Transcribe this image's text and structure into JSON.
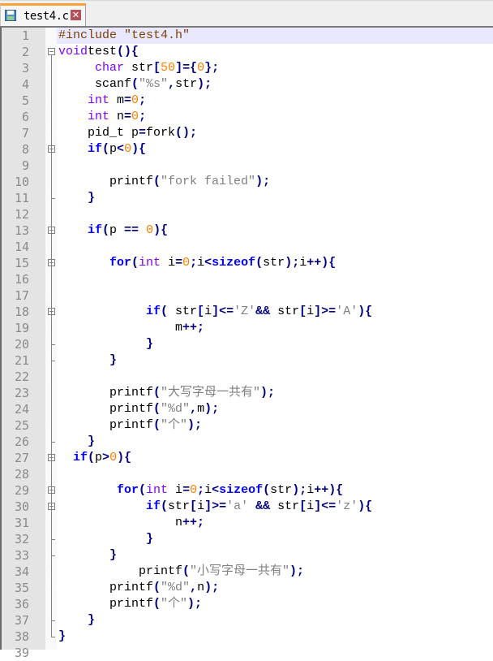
{
  "tab": {
    "filename": "test4.c",
    "save_icon": "floppy-disk-icon",
    "close_icon": "close-icon"
  },
  "editor": {
    "current_line": 1,
    "lines": [
      {
        "n": "1",
        "indent": 0,
        "tokens": [
          [
            "pp",
            "#include \"test4.h\""
          ]
        ],
        "fold": ""
      },
      {
        "n": "2",
        "indent": -1,
        "tokens": [
          [
            "ty",
            "void"
          ],
          [
            "",
            "test"
          ],
          [
            "op",
            "(){"
          ]
        ],
        "fold": "open"
      },
      {
        "n": "3",
        "indent": 5,
        "tokens": [
          [
            "ty",
            "char"
          ],
          [
            "",
            " str"
          ],
          [
            "op",
            "["
          ],
          [
            "num",
            "50"
          ],
          [
            "op",
            "]={"
          ],
          [
            "num",
            "0"
          ],
          [
            "op",
            "};"
          ]
        ],
        "fold": ""
      },
      {
        "n": "4",
        "indent": 5,
        "tokens": [
          [
            "",
            "scanf"
          ],
          [
            "op",
            "("
          ],
          [
            "str",
            "\"%s\""
          ],
          [
            "op",
            ","
          ],
          [
            "",
            "str"
          ],
          [
            "op",
            ");"
          ]
        ],
        "fold": ""
      },
      {
        "n": "5",
        "indent": 4,
        "tokens": [
          [
            "ty",
            "int"
          ],
          [
            "",
            " m"
          ],
          [
            "op",
            "="
          ],
          [
            "num",
            "0"
          ],
          [
            "op",
            ";"
          ]
        ],
        "fold": ""
      },
      {
        "n": "6",
        "indent": 4,
        "tokens": [
          [
            "ty",
            "int"
          ],
          [
            "",
            " n"
          ],
          [
            "op",
            "="
          ],
          [
            "num",
            "0"
          ],
          [
            "op",
            ";"
          ]
        ],
        "fold": ""
      },
      {
        "n": "7",
        "indent": 4,
        "tokens": [
          [
            "",
            "pid_t p"
          ],
          [
            "op",
            "="
          ],
          [
            "",
            "fork"
          ],
          [
            "op",
            "();"
          ]
        ],
        "fold": ""
      },
      {
        "n": "8",
        "indent": 4,
        "tokens": [
          [
            "kw",
            "if"
          ],
          [
            "op",
            "("
          ],
          [
            "",
            "p"
          ],
          [
            "op",
            "<"
          ],
          [
            "num",
            "0"
          ],
          [
            "op",
            "){"
          ]
        ],
        "fold": "open"
      },
      {
        "n": "9",
        "indent": 0,
        "tokens": [],
        "fold": ""
      },
      {
        "n": "10",
        "indent": 7,
        "tokens": [
          [
            "",
            "printf"
          ],
          [
            "op",
            "("
          ],
          [
            "str",
            "\"fork failed\""
          ],
          [
            "op",
            ");"
          ]
        ],
        "fold": ""
      },
      {
        "n": "11",
        "indent": 4,
        "tokens": [
          [
            "op",
            "}"
          ]
        ],
        "fold": "end"
      },
      {
        "n": "12",
        "indent": 0,
        "tokens": [],
        "fold": ""
      },
      {
        "n": "13",
        "indent": 4,
        "tokens": [
          [
            "kw",
            "if"
          ],
          [
            "op",
            "("
          ],
          [
            "",
            "p "
          ],
          [
            "op",
            "=="
          ],
          [
            "",
            " "
          ],
          [
            "num",
            "0"
          ],
          [
            "op",
            "){"
          ]
        ],
        "fold": "open"
      },
      {
        "n": "14",
        "indent": 0,
        "tokens": [],
        "fold": ""
      },
      {
        "n": "15",
        "indent": 7,
        "tokens": [
          [
            "kw",
            "for"
          ],
          [
            "op",
            "("
          ],
          [
            "ty",
            "int"
          ],
          [
            "",
            " i"
          ],
          [
            "op",
            "="
          ],
          [
            "num",
            "0"
          ],
          [
            "op",
            ";"
          ],
          [
            "",
            "i"
          ],
          [
            "op",
            "<"
          ],
          [
            "kw",
            "sizeof"
          ],
          [
            "op",
            "("
          ],
          [
            "",
            "str"
          ],
          [
            "op",
            ");"
          ],
          [
            "",
            "i"
          ],
          [
            "op",
            "++){"
          ]
        ],
        "fold": "open"
      },
      {
        "n": "16",
        "indent": 0,
        "tokens": [],
        "fold": ""
      },
      {
        "n": "17",
        "indent": 0,
        "tokens": [],
        "fold": ""
      },
      {
        "n": "18",
        "indent": 12,
        "tokens": [
          [
            "kw",
            "if"
          ],
          [
            "op",
            "("
          ],
          [
            "",
            " str"
          ],
          [
            "op",
            "["
          ],
          [
            "",
            "i"
          ],
          [
            "op",
            "]<="
          ],
          [
            "str",
            "'Z'"
          ],
          [
            "op",
            "&&"
          ],
          [
            "",
            " str"
          ],
          [
            "op",
            "["
          ],
          [
            "",
            "i"
          ],
          [
            "op",
            "]>="
          ],
          [
            "str",
            "'A'"
          ],
          [
            "op",
            "){"
          ]
        ],
        "fold": "open"
      },
      {
        "n": "19",
        "indent": 16,
        "tokens": [
          [
            "",
            "m"
          ],
          [
            "op",
            "++;"
          ]
        ],
        "fold": ""
      },
      {
        "n": "20",
        "indent": 12,
        "tokens": [
          [
            "op",
            "}"
          ]
        ],
        "fold": "end"
      },
      {
        "n": "21",
        "indent": 7,
        "tokens": [
          [
            "op",
            "}"
          ]
        ],
        "fold": "end"
      },
      {
        "n": "22",
        "indent": 0,
        "tokens": [],
        "fold": ""
      },
      {
        "n": "23",
        "indent": 7,
        "tokens": [
          [
            "",
            "printf"
          ],
          [
            "op",
            "("
          ],
          [
            "str",
            "\"大写字母一共有\""
          ],
          [
            "op",
            ");"
          ]
        ],
        "fold": ""
      },
      {
        "n": "24",
        "indent": 7,
        "tokens": [
          [
            "",
            "printf"
          ],
          [
            "op",
            "("
          ],
          [
            "str",
            "\"%d\""
          ],
          [
            "op",
            ","
          ],
          [
            "",
            "m"
          ],
          [
            "op",
            ");"
          ]
        ],
        "fold": ""
      },
      {
        "n": "25",
        "indent": 7,
        "tokens": [
          [
            "",
            "printf"
          ],
          [
            "op",
            "("
          ],
          [
            "str",
            "\"个\""
          ],
          [
            "op",
            ");"
          ]
        ],
        "fold": ""
      },
      {
        "n": "26",
        "indent": 4,
        "tokens": [
          [
            "op",
            "}"
          ]
        ],
        "fold": "end"
      },
      {
        "n": "27",
        "indent": 2,
        "tokens": [
          [
            "kw",
            "if"
          ],
          [
            "op",
            "("
          ],
          [
            "",
            "p"
          ],
          [
            "op",
            ">"
          ],
          [
            "num",
            "0"
          ],
          [
            "op",
            "){"
          ]
        ],
        "fold": "open"
      },
      {
        "n": "28",
        "indent": 0,
        "tokens": [],
        "fold": ""
      },
      {
        "n": "29",
        "indent": 8,
        "tokens": [
          [
            "kw",
            "for"
          ],
          [
            "op",
            "("
          ],
          [
            "ty",
            "int"
          ],
          [
            "",
            " i"
          ],
          [
            "op",
            "="
          ],
          [
            "num",
            "0"
          ],
          [
            "op",
            ";"
          ],
          [
            "",
            "i"
          ],
          [
            "op",
            "<"
          ],
          [
            "kw",
            "sizeof"
          ],
          [
            "op",
            "("
          ],
          [
            "",
            "str"
          ],
          [
            "op",
            ");"
          ],
          [
            "",
            "i"
          ],
          [
            "op",
            "++){"
          ]
        ],
        "fold": "open"
      },
      {
        "n": "30",
        "indent": 12,
        "tokens": [
          [
            "kw",
            "if"
          ],
          [
            "op",
            "("
          ],
          [
            "",
            "str"
          ],
          [
            "op",
            "["
          ],
          [
            "",
            "i"
          ],
          [
            "op",
            "]>="
          ],
          [
            "str",
            "'a'"
          ],
          [
            "",
            " "
          ],
          [
            "op",
            "&&"
          ],
          [
            "",
            " str"
          ],
          [
            "op",
            "["
          ],
          [
            "",
            "i"
          ],
          [
            "op",
            "]<="
          ],
          [
            "str",
            "'z'"
          ],
          [
            "op",
            "){"
          ]
        ],
        "fold": "open"
      },
      {
        "n": "31",
        "indent": 16,
        "tokens": [
          [
            "",
            "n"
          ],
          [
            "op",
            "++;"
          ]
        ],
        "fold": ""
      },
      {
        "n": "32",
        "indent": 12,
        "tokens": [
          [
            "op",
            "}"
          ]
        ],
        "fold": "end"
      },
      {
        "n": "33",
        "indent": 7,
        "tokens": [
          [
            "op",
            "}"
          ]
        ],
        "fold": "end"
      },
      {
        "n": "34",
        "indent": 11,
        "tokens": [
          [
            "",
            "printf"
          ],
          [
            "op",
            "("
          ],
          [
            "str",
            "\"小写字母一共有\""
          ],
          [
            "op",
            ");"
          ]
        ],
        "fold": ""
      },
      {
        "n": "35",
        "indent": 7,
        "tokens": [
          [
            "",
            "printf"
          ],
          [
            "op",
            "("
          ],
          [
            "str",
            "\"%d\""
          ],
          [
            "op",
            ","
          ],
          [
            "",
            "n"
          ],
          [
            "op",
            ");"
          ]
        ],
        "fold": ""
      },
      {
        "n": "36",
        "indent": 7,
        "tokens": [
          [
            "",
            "printf"
          ],
          [
            "op",
            "("
          ],
          [
            "str",
            "\"个\""
          ],
          [
            "op",
            ");"
          ]
        ],
        "fold": ""
      },
      {
        "n": "37",
        "indent": 4,
        "tokens": [
          [
            "op",
            "}"
          ]
        ],
        "fold": "end"
      },
      {
        "n": "38",
        "indent": 0,
        "tokens": [
          [
            "op",
            "}"
          ]
        ],
        "fold": "end"
      },
      {
        "n": "39",
        "indent": 0,
        "tokens": [],
        "fold": ""
      }
    ]
  }
}
